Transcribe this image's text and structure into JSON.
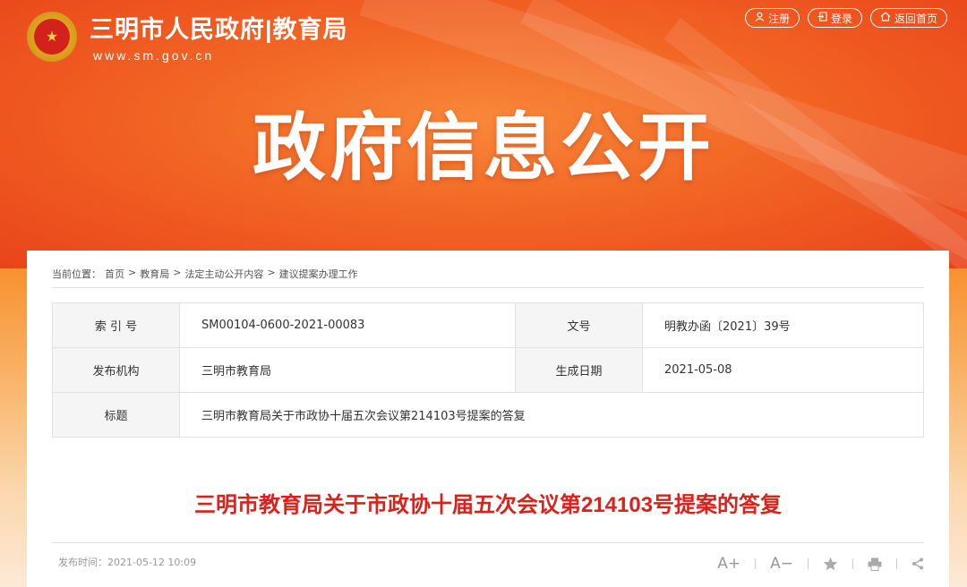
{
  "site": {
    "name": "三明市人民政府",
    "dept": "|教育局",
    "url": "www.sm.gov.cn"
  },
  "top_nav": [
    {
      "label": "注册",
      "icon": "user-icon"
    },
    {
      "label": "登录",
      "icon": "login-icon"
    },
    {
      "label": "返回首页",
      "icon": "home-icon"
    }
  ],
  "hero_title": "政府信息公开",
  "breadcrumb": {
    "prefix": "当前位置：",
    "items": [
      "首页",
      "教育局",
      "法定主动公开内容",
      "建议提案办理工作"
    ],
    "separator": ">"
  },
  "meta": {
    "index_label": "索 引 号",
    "index_value": "SM00104-0600-2021-00083",
    "doc_no_label": "文号",
    "doc_no_value": "明教办函〔2021〕39号",
    "publisher_label": "发布机构",
    "publisher_value": "三明市教育局",
    "date_label": "生成日期",
    "date_value": "2021-05-08",
    "title_label": "标题",
    "title_value": "三明市教育局关于市政协十届五次会议第214103号提案的答复"
  },
  "article": {
    "title": "三明市教育局关于市政协十届五次会议第214103号提案的答复",
    "publish_time": "发布时间：2021-05-12 10:09"
  },
  "tools": {
    "font_increase": "A+",
    "font_decrease": "A−"
  },
  "colors": {
    "brand_red": "#d9221c",
    "hero_orange": "#f26524"
  }
}
